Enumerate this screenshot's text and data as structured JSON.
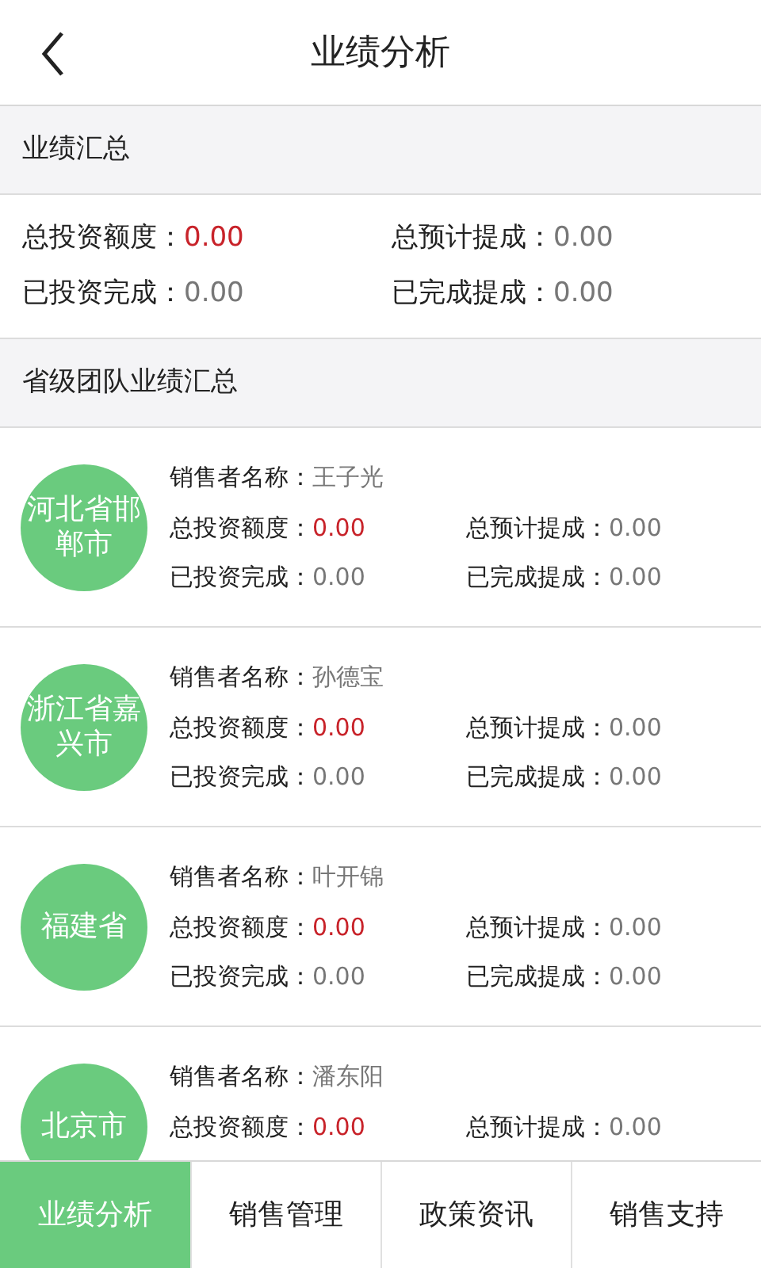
{
  "header": {
    "title": "业绩分析"
  },
  "summary": {
    "title": "业绩汇总",
    "stats": [
      {
        "label": "总投资额度：",
        "value": "0.00",
        "emphasis": true
      },
      {
        "label": "总预计提成：",
        "value": "0.00",
        "emphasis": false
      },
      {
        "label": "已投资完成：",
        "value": "0.00",
        "emphasis": false
      },
      {
        "label": "已完成提成：",
        "value": "0.00",
        "emphasis": false
      }
    ]
  },
  "teams": {
    "title": "省级团队业绩汇总",
    "items": [
      {
        "region": "河北省邯郸市",
        "name_label": "销售者名称：",
        "name": "王子光",
        "stats": [
          {
            "label": "总投资额度：",
            "value": "0.00",
            "emphasis": true
          },
          {
            "label": "总预计提成：",
            "value": "0.00",
            "emphasis": false
          },
          {
            "label": "已投资完成：",
            "value": "0.00",
            "emphasis": false
          },
          {
            "label": "已完成提成：",
            "value": "0.00",
            "emphasis": false
          }
        ]
      },
      {
        "region": "浙江省嘉兴市",
        "name_label": "销售者名称：",
        "name": "孙德宝",
        "stats": [
          {
            "label": "总投资额度：",
            "value": "0.00",
            "emphasis": true
          },
          {
            "label": "总预计提成：",
            "value": "0.00",
            "emphasis": false
          },
          {
            "label": "已投资完成：",
            "value": "0.00",
            "emphasis": false
          },
          {
            "label": "已完成提成：",
            "value": "0.00",
            "emphasis": false
          }
        ]
      },
      {
        "region": "福建省",
        "name_label": "销售者名称：",
        "name": "叶开锦",
        "stats": [
          {
            "label": "总投资额度：",
            "value": "0.00",
            "emphasis": true
          },
          {
            "label": "总预计提成：",
            "value": "0.00",
            "emphasis": false
          },
          {
            "label": "已投资完成：",
            "value": "0.00",
            "emphasis": false
          },
          {
            "label": "已完成提成：",
            "value": "0.00",
            "emphasis": false
          }
        ]
      },
      {
        "region": "北京市",
        "name_label": "销售者名称：",
        "name": "潘东阳",
        "stats": [
          {
            "label": "总投资额度：",
            "value": "0.00",
            "emphasis": true
          },
          {
            "label": "总预计提成：",
            "value": "0.00",
            "emphasis": false
          }
        ]
      }
    ]
  },
  "tabs": [
    {
      "label": "业绩分析",
      "selected": true
    },
    {
      "label": "销售管理",
      "selected": false
    },
    {
      "label": "政策资讯",
      "selected": false
    },
    {
      "label": "销售支持",
      "selected": false
    }
  ]
}
